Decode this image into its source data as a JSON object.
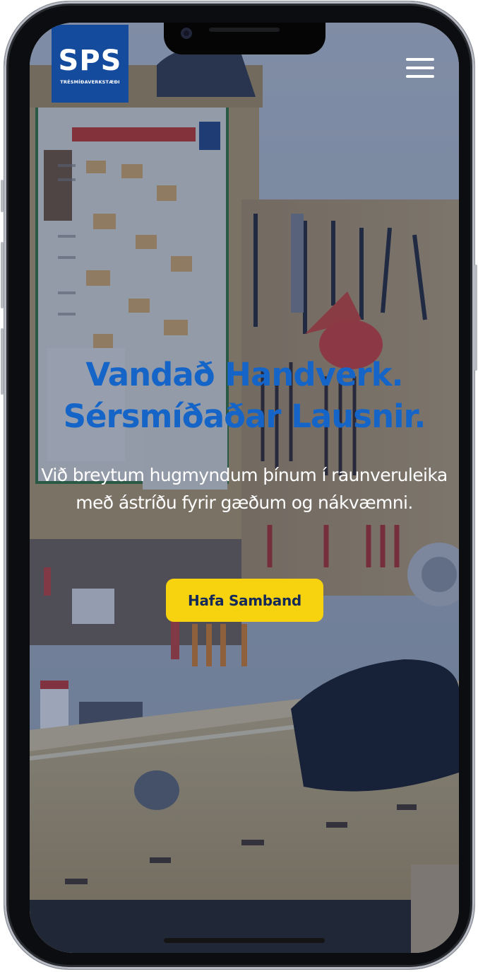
{
  "logo": {
    "mark": "SPS",
    "subtitle": "TRÉSMÍÐAVERKSTÆÐI"
  },
  "nav": {
    "menu_icon": "hamburger-menu-icon"
  },
  "hero": {
    "title_line1": "Vandað Handverk.",
    "title_line2": "Sérsmíðaðar Lausnir.",
    "text": "Við breytum hugmyndum þínum í raunveruleika með ástríðu fyrir gæðum og nákvæmni.",
    "cta_label": "Hafa Samband",
    "background": "workshop-photo"
  },
  "colors": {
    "brand_blue": "#154b9c",
    "title_blue": "#1565c8",
    "cta_yellow": "#f6d30e",
    "cta_text": "#162a5a"
  }
}
